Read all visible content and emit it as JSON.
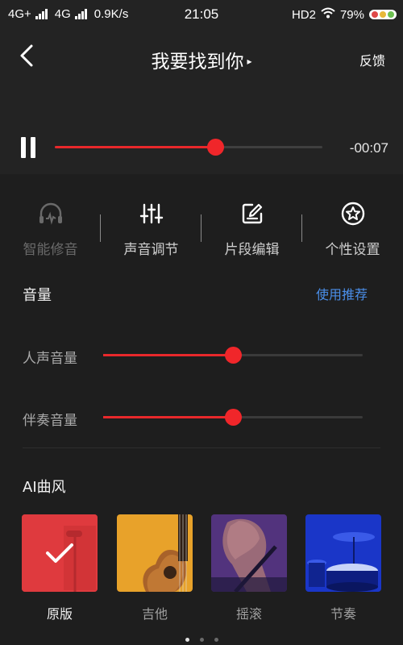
{
  "status_bar": {
    "network1": "4G+",
    "network2": "4G",
    "speed": "0.9K/s",
    "time": "21:05",
    "hd": "HD2",
    "battery": "79%",
    "icons": [
      "signal-icon",
      "wifi-icon",
      "battery-icon"
    ]
  },
  "header": {
    "title": "我要找到你",
    "title_indicator": "▸",
    "feedback": "反馈"
  },
  "player": {
    "state": "playing",
    "progress": 0.6,
    "time_remaining": "-00:07"
  },
  "tools": [
    {
      "label": "智能修音",
      "icon": "headphones-waveform-icon",
      "enabled": false
    },
    {
      "label": "声音调节",
      "icon": "equalizer-sliders-icon",
      "enabled": true
    },
    {
      "label": "片段编辑",
      "icon": "edit-square-icon",
      "enabled": true
    },
    {
      "label": "个性设置",
      "icon": "star-badge-icon",
      "enabled": true
    }
  ],
  "volume": {
    "title": "音量",
    "recommend": "使用推荐",
    "vocal_label": "人声音量",
    "vocal_level": 0.5,
    "accompaniment_label": "伴奏音量",
    "accompaniment_level": 0.5
  },
  "ai_style": {
    "title": "AI曲风",
    "items": [
      {
        "name": "原版",
        "selected": true
      },
      {
        "name": "吉他",
        "selected": false
      },
      {
        "name": "摇滚",
        "selected": false
      },
      {
        "name": "节奏",
        "selected": false
      }
    ]
  },
  "pager": {
    "pages": 3,
    "current": 0
  },
  "colors": {
    "accent_red": "#e8282b",
    "link_blue": "#4a8ee8",
    "background": "#1e1e1e"
  }
}
